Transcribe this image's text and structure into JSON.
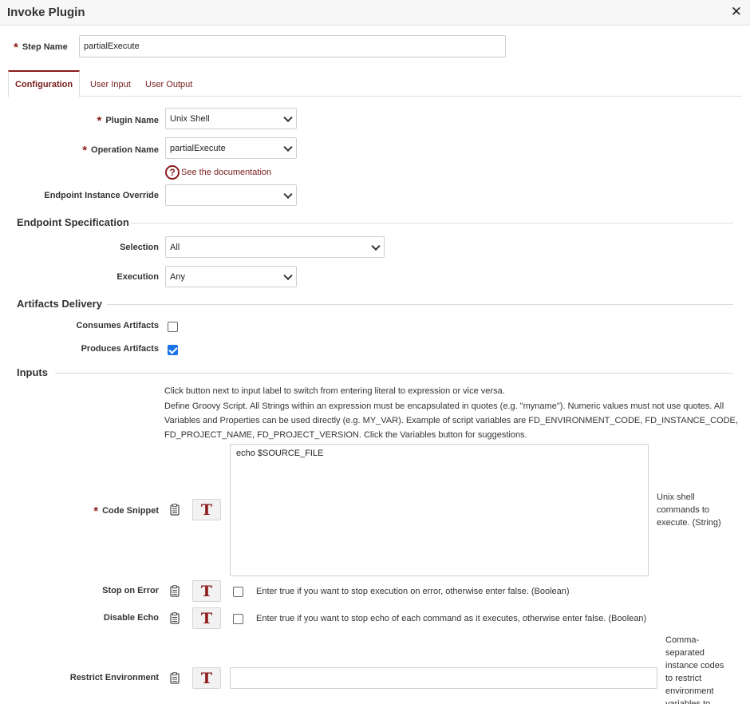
{
  "window": {
    "title": "Invoke Plugin",
    "close_icon": "✕"
  },
  "step_name": {
    "label": "Step Name",
    "value": "partialExecute"
  },
  "tabs": [
    {
      "label": "Configuration",
      "active": true
    },
    {
      "label": "User Input",
      "active": false
    },
    {
      "label": "User Output",
      "active": false
    }
  ],
  "config": {
    "plugin_name": {
      "label": "Plugin Name",
      "value": "Unix Shell"
    },
    "operation_name": {
      "label": "Operation Name",
      "value": "partialExecute"
    },
    "doc_link": "See the documentation",
    "endpoint_override": {
      "label": "Endpoint Instance Override",
      "value": ""
    }
  },
  "endpoint_spec": {
    "title": "Endpoint Specification",
    "selection": {
      "label": "Selection",
      "value": "All"
    },
    "execution": {
      "label": "Execution",
      "value": "Any"
    }
  },
  "artifacts": {
    "title": "Artifacts Delivery",
    "consumes": {
      "label": "Consumes Artifacts",
      "checked": false
    },
    "produces": {
      "label": "Produces Artifacts",
      "checked": true
    }
  },
  "inputs": {
    "title": "Inputs",
    "help1": "Click button next to input label to switch from entering literal to expression or vice versa.",
    "help2_line1": "Define Groovy Script. All Strings within an expression must be encapsulated in quotes (e.g. \"myname\"). Numeric values must not use quotes. All",
    "help2_line2": "Variables and Properties can be used directly (e.g. MY_VAR). Example of script variables are FD_ENVIRONMENT_CODE, FD_INSTANCE_CODE,",
    "help2_line3": "FD_PROJECT_NAME, FD_PROJECT_VERSION. Click the Variables button for suggestions.",
    "toggle_button_glyph": "T",
    "code_snippet": {
      "label": "Code Snippet",
      "value": "echo $SOURCE_FILE",
      "desc_line1": "Unix shell",
      "desc_line2": "commands to",
      "desc_line3": "execute. (String)"
    },
    "stop_on_error": {
      "label": "Stop on Error",
      "checked": false,
      "desc": "Enter true if you want to stop execution on error, otherwise enter false. (Boolean)"
    },
    "disable_echo": {
      "label": "Disable Echo",
      "checked": false,
      "desc": "Enter true if you want to stop echo of each command as it executes, otherwise enter false. (Boolean)"
    },
    "restrict_environment": {
      "label": "Restrict Environment",
      "value": "",
      "desc_line1": "Comma-",
      "desc_line2": "separated",
      "desc_line3": "instance codes",
      "desc_line4": "to restrict",
      "desc_line5": "environment",
      "desc_line6": "variables to"
    }
  },
  "colors": {
    "accent": "#8b1a1a",
    "checkbox_checked": "#1a73e8"
  }
}
